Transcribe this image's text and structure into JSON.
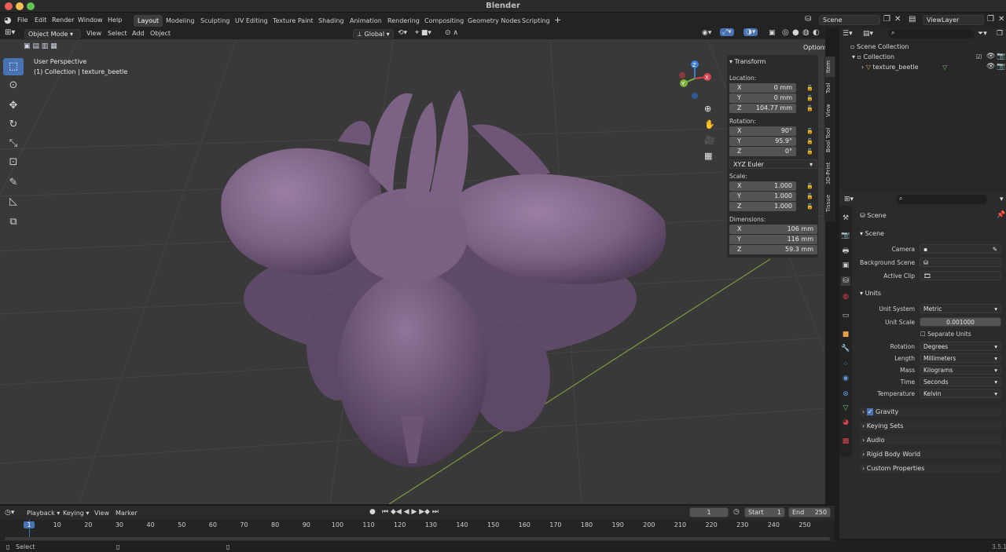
{
  "app_title": "Blender",
  "menu": [
    "File",
    "Edit",
    "Render",
    "Window",
    "Help"
  ],
  "workspaces": [
    "Layout",
    "Modeling",
    "Sculpting",
    "UV Editing",
    "Texture Paint",
    "Shading",
    "Animation",
    "Rendering",
    "Compositing",
    "Geometry Nodes",
    "Scripting"
  ],
  "active_workspace": "Layout",
  "scene_name": "Scene",
  "view_layer": "ViewLayer",
  "viewport_header": {
    "mode": "Object Mode",
    "menus": [
      "View",
      "Select",
      "Add",
      "Object"
    ],
    "orientation": "Global",
    "options": "Options"
  },
  "viewport_overlay": {
    "line1": "User Perspective",
    "line2": "(1) Collection | texture_beetle"
  },
  "gizmo_axes": {
    "x": "X",
    "y": "Y",
    "z": "Z"
  },
  "npanel": {
    "header": "Transform",
    "location_label": "Location:",
    "location": {
      "x": "0 mm",
      "y": "0 mm",
      "z": "104.77 mm"
    },
    "rotation_label": "Rotation:",
    "rotation": {
      "x": "90°",
      "y": "95.9°",
      "z": "0°"
    },
    "rotation_mode": "XYZ Euler",
    "scale_label": "Scale:",
    "scale": {
      "x": "1.000",
      "y": "1.000",
      "z": "1.000"
    },
    "dimensions_label": "Dimensions:",
    "dimensions": {
      "x": "106 mm",
      "y": "116 mm",
      "z": "59.3 mm"
    },
    "tabs": [
      "Item",
      "Tool",
      "View",
      "Bool Tool",
      "3D-Print",
      "Tissue"
    ]
  },
  "outliner": {
    "root": "Scene Collection",
    "collection": "Collection",
    "object": "texture_beetle"
  },
  "properties": {
    "header": "Scene",
    "scene_section": "Scene",
    "camera_label": "Camera",
    "background_scene_label": "Background Scene",
    "active_clip_label": "Active Clip",
    "units_section": "Units",
    "unit_system_label": "Unit System",
    "unit_system": "Metric",
    "unit_scale_label": "Unit Scale",
    "unit_scale": "0.001000",
    "separate_units": "Separate Units",
    "rotation_label": "Rotation",
    "rotation": "Degrees",
    "length_label": "Length",
    "length": "Millimeters",
    "mass_label": "Mass",
    "mass": "Kilograms",
    "time_label": "Time",
    "time": "Seconds",
    "temperature_label": "Temperature",
    "temperature": "Kelvin",
    "gravity": "Gravity",
    "keying_sets": "Keying Sets",
    "audio": "Audio",
    "rigid_body_world": "Rigid Body World",
    "custom_properties": "Custom Properties"
  },
  "timeline": {
    "menus": [
      "Playback",
      "Keying",
      "View",
      "Marker"
    ],
    "current_frame": "1",
    "start_label": "Start",
    "start": "1",
    "end_label": "End",
    "end": "250",
    "ticks": [
      "1",
      "10",
      "20",
      "30",
      "40",
      "50",
      "60",
      "70",
      "80",
      "90",
      "100",
      "110",
      "120",
      "130",
      "140",
      "150",
      "160",
      "170",
      "180",
      "190",
      "200",
      "210",
      "220",
      "230",
      "240",
      "250"
    ]
  },
  "status": {
    "left": "Select",
    "version": "3.5.1"
  }
}
